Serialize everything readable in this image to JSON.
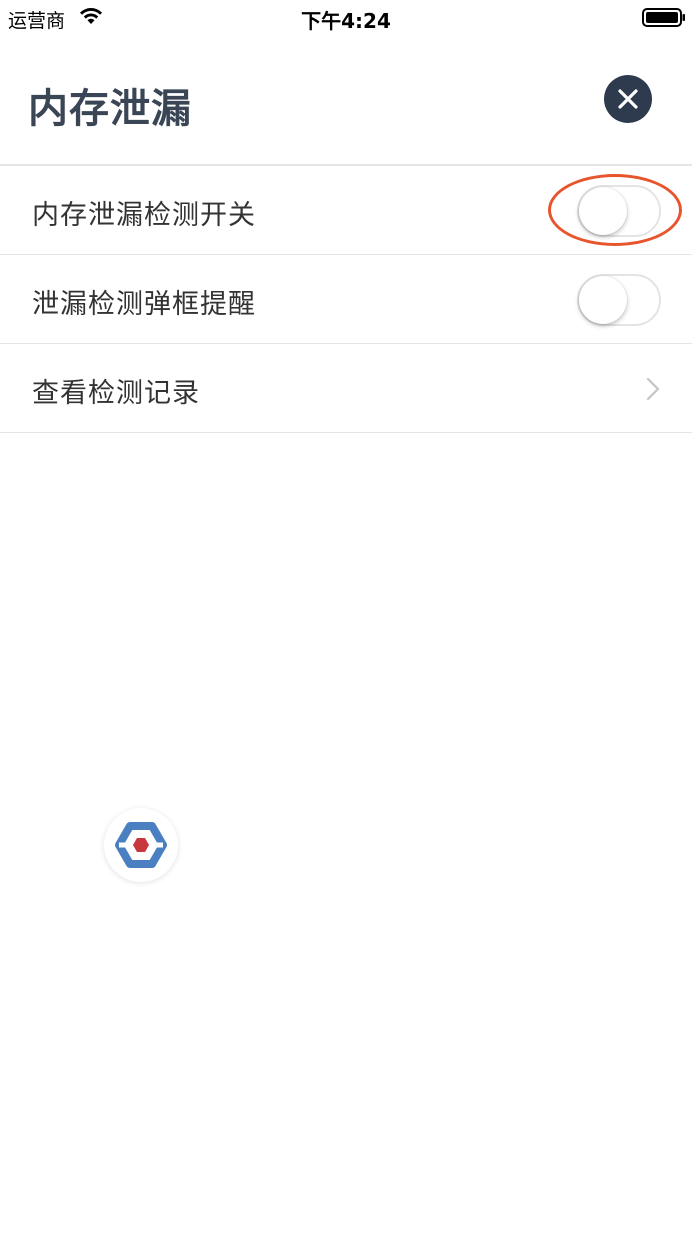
{
  "status_bar": {
    "carrier": "运营商",
    "time": "下午4:24",
    "wifi_icon": "wifi-icon",
    "battery_icon": "battery-icon"
  },
  "header": {
    "title": "内存泄漏",
    "close_icon": "close-icon"
  },
  "settings": [
    {
      "label": "内存泄漏检测开关",
      "type": "toggle",
      "on": false,
      "highlighted": true
    },
    {
      "label": "泄漏检测弹框提醒",
      "type": "toggle",
      "on": false
    },
    {
      "label": "查看检测记录",
      "type": "link",
      "icon": "chevron-right-icon"
    }
  ],
  "floating_button": {
    "icon": "hexagon-logo-icon"
  },
  "colors": {
    "title": "#3a4556",
    "close_button_bg": "#2e3a4e",
    "divider": "#e6e6e6",
    "highlight": "#e8542c",
    "logo_blue": "#4a7fc1",
    "logo_red": "#c8363e"
  }
}
